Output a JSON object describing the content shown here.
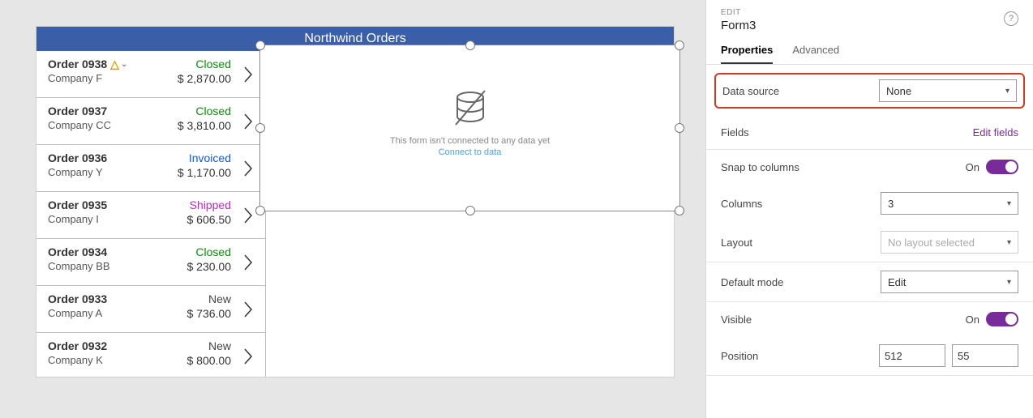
{
  "title": "Northwind Orders",
  "orders": [
    {
      "num": "Order 0938",
      "company": "Company F",
      "status": "Closed",
      "status_cls": "closed",
      "price": "$ 2,870.00",
      "warn": true
    },
    {
      "num": "Order 0937",
      "company": "Company CC",
      "status": "Closed",
      "status_cls": "closed",
      "price": "$ 3,810.00",
      "warn": false
    },
    {
      "num": "Order 0936",
      "company": "Company Y",
      "status": "Invoiced",
      "status_cls": "invoiced",
      "price": "$ 1,170.00",
      "warn": false
    },
    {
      "num": "Order 0935",
      "company": "Company I",
      "status": "Shipped",
      "status_cls": "shipped",
      "price": "$ 606.50",
      "warn": false
    },
    {
      "num": "Order 0934",
      "company": "Company BB",
      "status": "Closed",
      "status_cls": "closed",
      "price": "$ 230.00",
      "warn": false
    },
    {
      "num": "Order 0933",
      "company": "Company A",
      "status": "New",
      "status_cls": "new",
      "price": "$ 736.00",
      "warn": false
    },
    {
      "num": "Order 0932",
      "company": "Company K",
      "status": "New",
      "status_cls": "new",
      "price": "$ 800.00",
      "warn": false
    }
  ],
  "form_empty": {
    "msg": "This form isn't connected to any data yet",
    "link": "Connect to data"
  },
  "panel": {
    "edit_label": "EDIT",
    "control_name": "Form3",
    "tabs": {
      "properties": "Properties",
      "advanced": "Advanced"
    },
    "data_source": {
      "label": "Data source",
      "value": "None"
    },
    "fields": {
      "label": "Fields",
      "action": "Edit fields"
    },
    "snap": {
      "label": "Snap to columns",
      "value": "On"
    },
    "columns": {
      "label": "Columns",
      "value": "3"
    },
    "layout": {
      "label": "Layout",
      "value": "No layout selected"
    },
    "default_mode": {
      "label": "Default mode",
      "value": "Edit"
    },
    "visible": {
      "label": "Visible",
      "value": "On"
    },
    "position": {
      "label": "Position",
      "x": "512",
      "y": "55"
    }
  }
}
